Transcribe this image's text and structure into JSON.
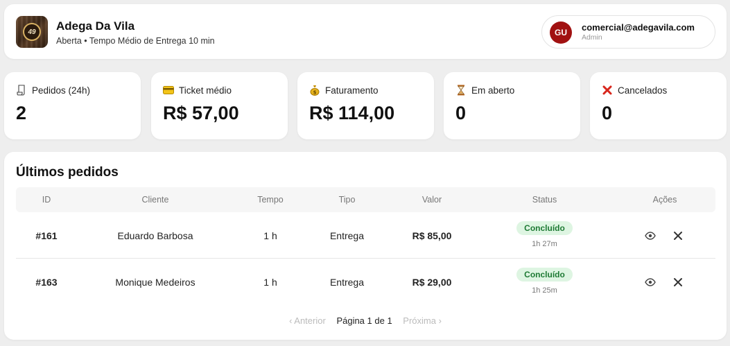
{
  "header": {
    "brand_name": "Adega Da Vila",
    "brand_logo_text": "49",
    "brand_sub": "Aberta • Tempo Médio de Entrega 10 min",
    "user": {
      "initials": "GU",
      "email": "comercial@adegavila.com",
      "role": "Admin"
    }
  },
  "stats": [
    {
      "label": "Pedidos (24h)",
      "value": "2",
      "icon": "receipt-icon"
    },
    {
      "label": "Ticket médio",
      "value": "R$ 57,00",
      "icon": "credit-card-icon"
    },
    {
      "label": "Faturamento",
      "value": "R$ 114,00",
      "icon": "money-bag-icon"
    },
    {
      "label": "Em aberto",
      "value": "0",
      "icon": "hourglass-icon"
    },
    {
      "label": "Cancelados",
      "value": "0",
      "icon": "cross-mark-icon"
    }
  ],
  "orders": {
    "title": "Últimos pedidos",
    "columns": [
      "ID",
      "Cliente",
      "Tempo",
      "Tipo",
      "Valor",
      "Status",
      "Ações"
    ],
    "rows": [
      {
        "id": "#161",
        "cliente": "Eduardo Barbosa",
        "tempo": "1 h",
        "tipo": "Entrega",
        "valor": "R$ 85,00",
        "status": "Concluído",
        "status_time": "1h 27m"
      },
      {
        "id": "#163",
        "cliente": "Monique Medeiros",
        "tempo": "1 h",
        "tipo": "Entrega",
        "valor": "R$ 29,00",
        "status": "Concluído",
        "status_time": "1h 25m"
      }
    ],
    "pagination": {
      "prev": "‹ Anterior",
      "current": "Página 1 de 1",
      "next": "Próxima ›"
    }
  },
  "colors": {
    "avatar": "#a11111",
    "status_success_bg": "#def5e2",
    "status_success_text": "#1e7a34"
  }
}
